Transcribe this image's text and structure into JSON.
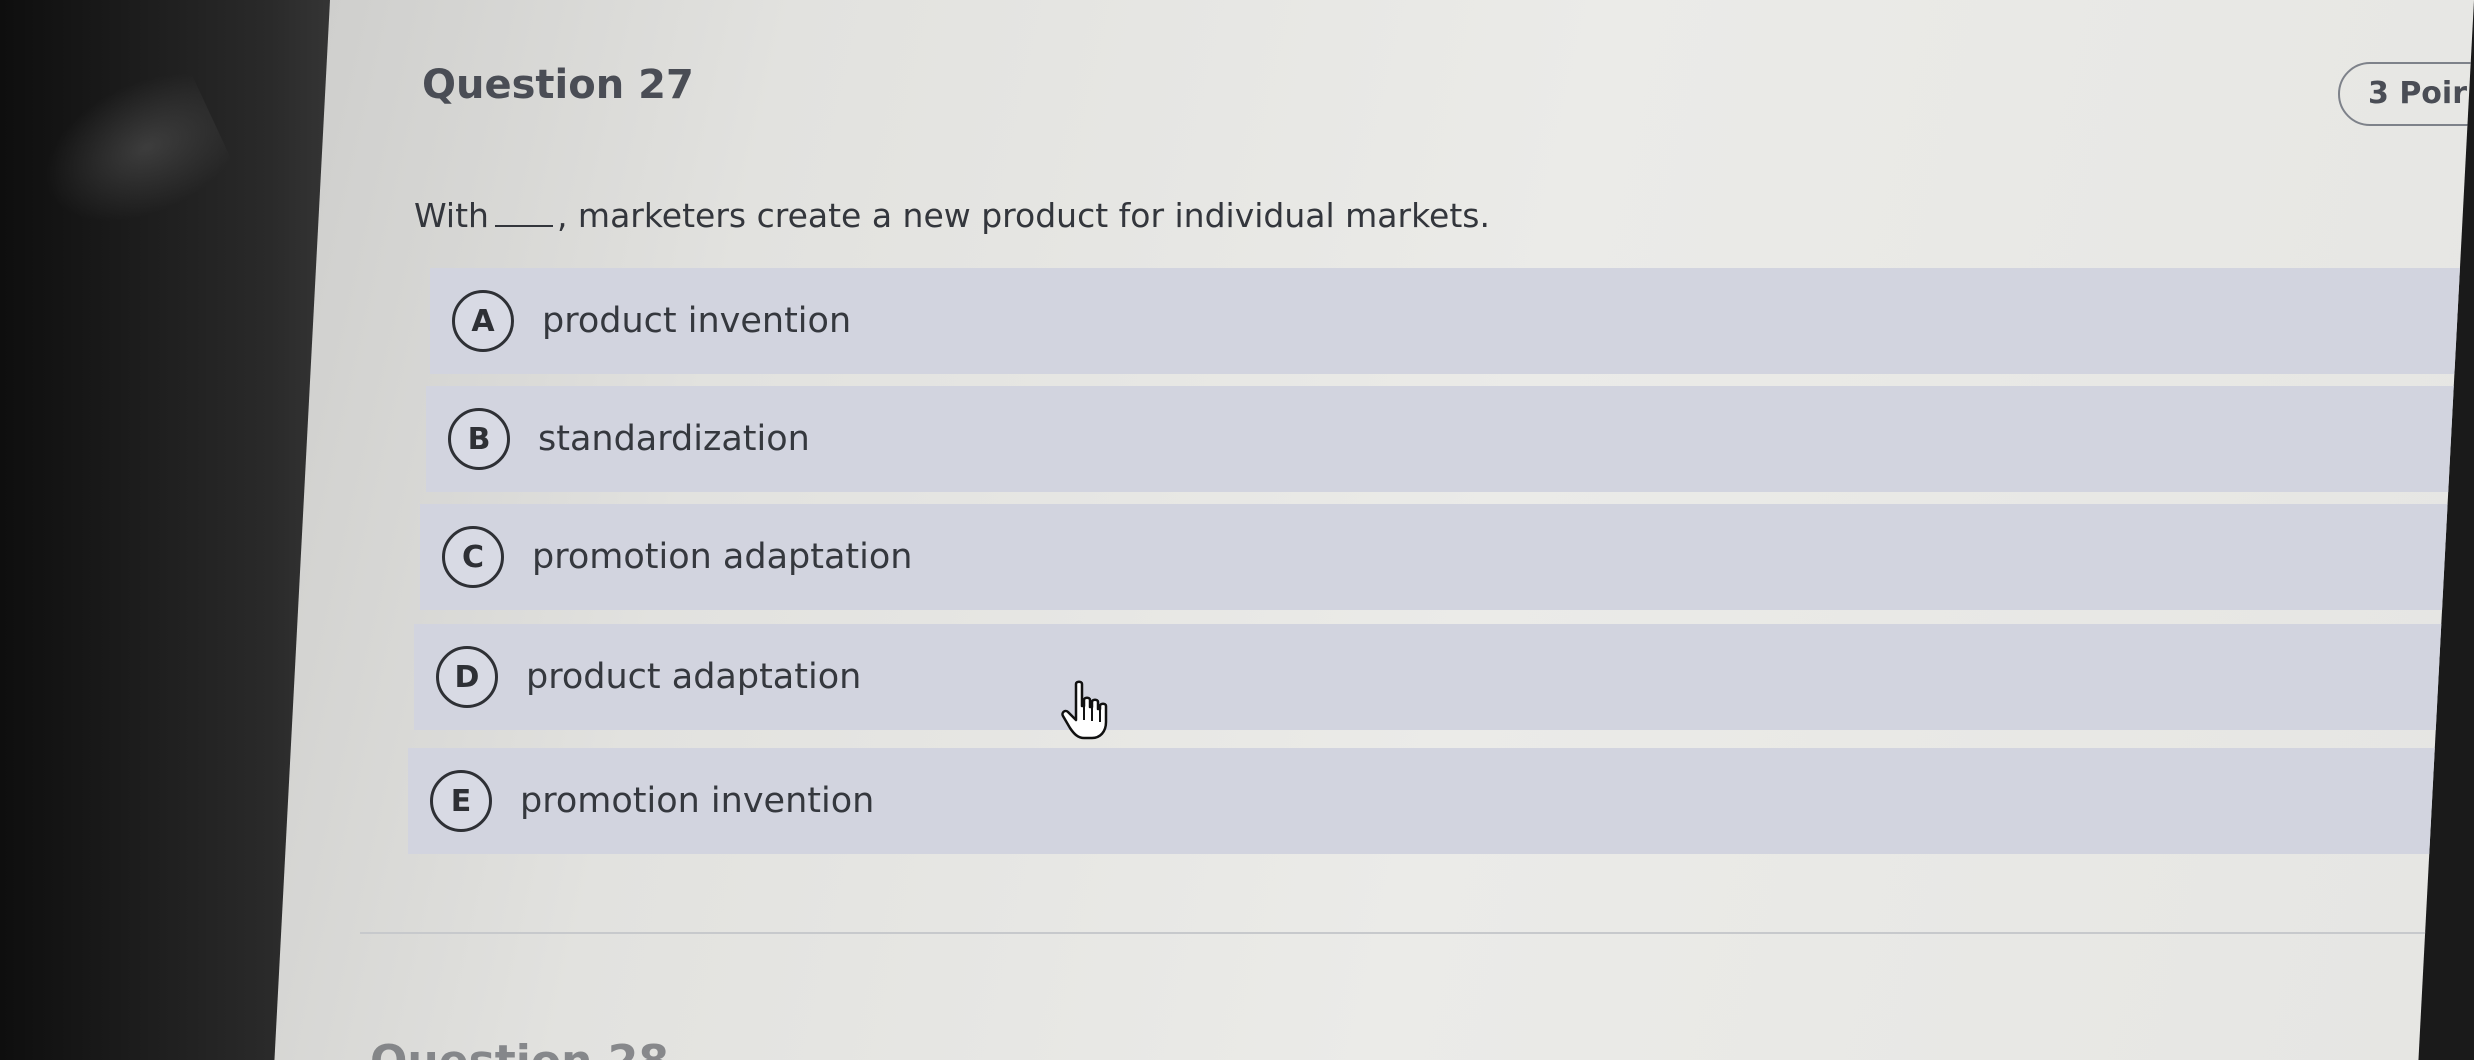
{
  "question": {
    "title": "Question 27",
    "points": "3 Poir",
    "prompt_before": "With",
    "prompt_after": ", marketers create a new product for individual markets."
  },
  "options": [
    {
      "letter": "A",
      "text": "product invention"
    },
    {
      "letter": "B",
      "text": "standardization"
    },
    {
      "letter": "C",
      "text": "promotion adaptation"
    },
    {
      "letter": "D",
      "text": "product adaptation"
    },
    {
      "letter": "E",
      "text": "promotion invention"
    }
  ],
  "next_question_peek": "Question 28",
  "icons": {
    "cursor": "hand-pointer-icon"
  },
  "colors": {
    "option_background": "#d2d4df",
    "text": "#35383e",
    "screen_background": "#e6e6e3"
  }
}
